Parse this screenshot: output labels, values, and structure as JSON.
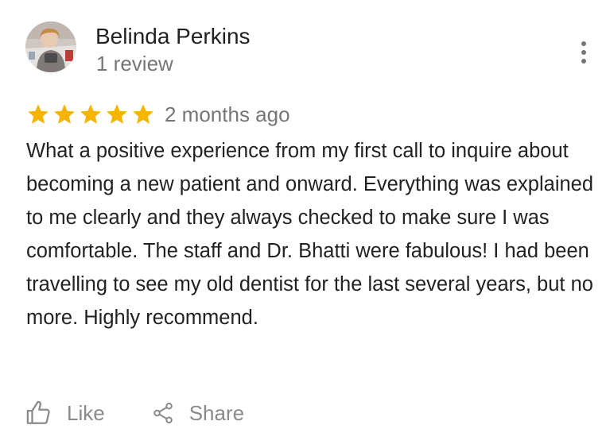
{
  "reviewer": {
    "name": "Belinda Perkins",
    "review_count": "1 review",
    "avatar_icon": "person-photo-icon"
  },
  "review": {
    "rating": 5,
    "max_rating": 5,
    "date": "2 months ago",
    "text": "What a positive experience from my first call to inquire about becoming a new patient and onward. Everything was explained to me clearly and they always checked to make sure I was comfortable. The staff and Dr. Bhatti were fabulous! I had been travelling to see my old dentist for the last several years, but no more. Highly recommend."
  },
  "actions": {
    "like_label": "Like",
    "share_label": "Share"
  },
  "menu": {
    "icon": "more-vert-icon"
  },
  "colors": {
    "star": "#F4B400",
    "text": "#222222",
    "secondary_text": "#767676",
    "action_text": "#8a8a8a"
  }
}
